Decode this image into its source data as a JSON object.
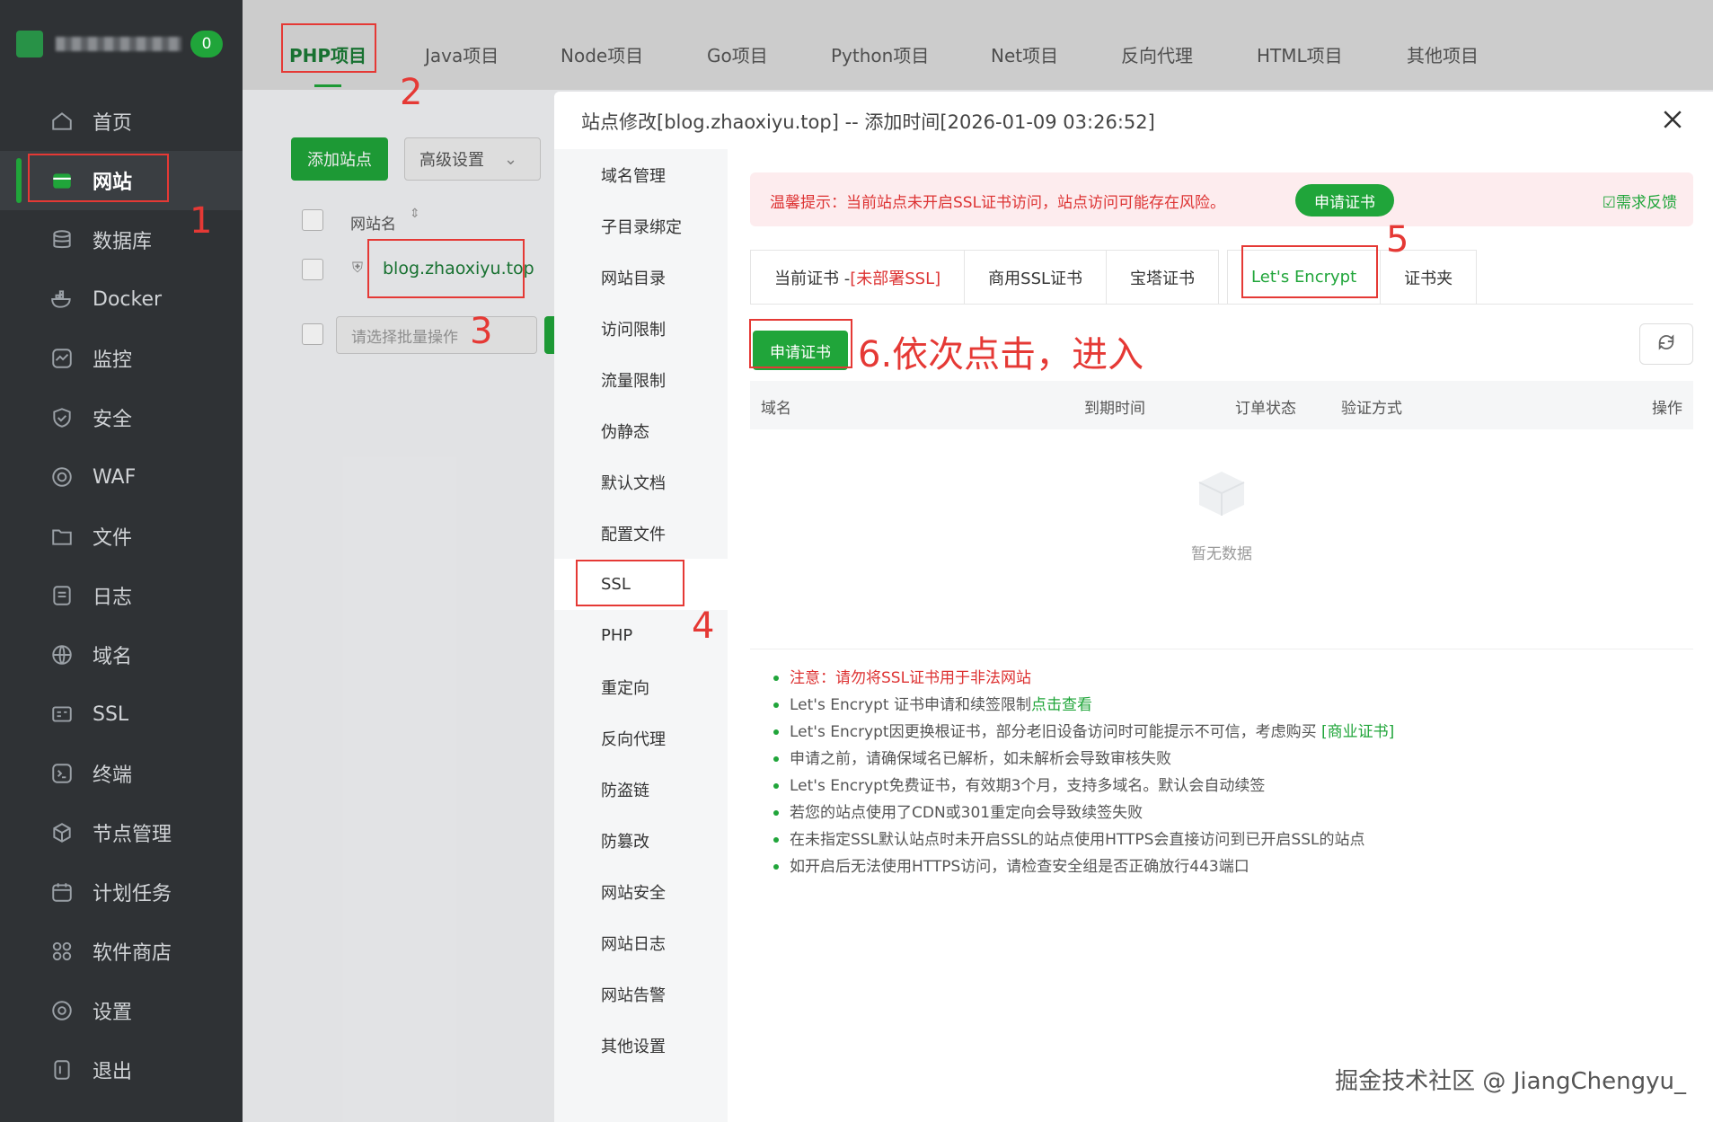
{
  "sidebar": {
    "badge": "0",
    "items": [
      {
        "label": "首页",
        "icon": "home-icon"
      },
      {
        "label": "网站",
        "icon": "website-icon"
      },
      {
        "label": "数据库",
        "icon": "database-icon"
      },
      {
        "label": "Docker",
        "icon": "docker-icon"
      },
      {
        "label": "监控",
        "icon": "monitor-icon"
      },
      {
        "label": "安全",
        "icon": "shield-icon"
      },
      {
        "label": "WAF",
        "icon": "waf-icon"
      },
      {
        "label": "文件",
        "icon": "folder-icon"
      },
      {
        "label": "日志",
        "icon": "log-icon"
      },
      {
        "label": "域名",
        "icon": "globe-icon"
      },
      {
        "label": "SSL",
        "icon": "ssl-icon"
      },
      {
        "label": "终端",
        "icon": "terminal-icon"
      },
      {
        "label": "节点管理",
        "icon": "node-icon"
      },
      {
        "label": "计划任务",
        "icon": "calendar-icon"
      },
      {
        "label": "软件商店",
        "icon": "apps-icon"
      },
      {
        "label": "设置",
        "icon": "gear-icon"
      },
      {
        "label": "退出",
        "icon": "logout-icon"
      }
    ]
  },
  "topbar": {
    "tabs": [
      "PHP项目",
      "Java项目",
      "Node项目",
      "Go项目",
      "Python项目",
      "Net项目",
      "反向代理",
      "HTML项目",
      "其他项目"
    ]
  },
  "background_page": {
    "add_site": "添加站点",
    "advanced": "高级设置",
    "col_site_name": "网站名",
    "site": "blog.zhaoxiyu.top",
    "batch_placeholder": "请选择批量操作"
  },
  "modal": {
    "title": "站点修改[blog.zhaoxiyu.top] -- 添加时间[2026-01-09 03:26:52]",
    "side_items": [
      "域名管理",
      "子目录绑定",
      "网站目录",
      "访问限制",
      "流量限制",
      "伪静态",
      "默认文档",
      "配置文件",
      "SSL",
      "PHP",
      "重定向",
      "反向代理",
      "防盗链",
      "防篡改",
      "网站安全",
      "网站日志",
      "网站告警",
      "其他设置"
    ],
    "warning": {
      "text": "温馨提示：当前站点未开启SSL证书访问，站点访问可能存在风险。",
      "button": "申请证书",
      "feedback": "需求反馈"
    },
    "cert_tabs": {
      "current_prefix": "当前证书 - ",
      "current_status": "[未部署SSL]",
      "commercial": "商用SSL证书",
      "baota": "宝塔证书",
      "letsencrypt": "Let's Encrypt",
      "folder": "证书夹"
    },
    "apply_button": "申请证书",
    "table_headers": {
      "domain": "域名",
      "expire": "到期时间",
      "order": "订单状态",
      "verify": "验证方式",
      "action": "操作"
    },
    "empty_text": "暂无数据",
    "notes": {
      "n1": "注意：请勿将SSL证书用于非法网站",
      "n2_text": "Let's Encrypt 证书申请和续签限制",
      "n2_link": "点击查看",
      "n3_text": "Let's Encrypt因更换根证书，部分老旧设备访问时可能提示不可信，考虑购买 ",
      "n3_link": "[商业证书]",
      "n4": "申请之前，请确保域名已解析，如未解析会导致审核失败",
      "n5": "Let's Encrypt免费证书，有效期3个月，支持多域名。默认会自动续签",
      "n6": "若您的站点使用了CDN或301重定向会导致续签失败",
      "n7": "在未指定SSL默认站点时未开启SSL的站点使用HTTPS会直接访问到已开启SSL的站点",
      "n8": "如开启后无法使用HTTPS访问，请检查安全组是否正确放行443端口"
    }
  },
  "annotations": {
    "n1": "1",
    "n2": "2",
    "n3": "3",
    "n4": "4",
    "n5": "5",
    "step6": "6.依次点击，进入"
  },
  "watermark": "掘金技术社区 @ JiangChengyu_",
  "colors": {
    "accent": "#20a53a",
    "sidebar_bg": "#2f3235",
    "annotation": "#e53935"
  }
}
